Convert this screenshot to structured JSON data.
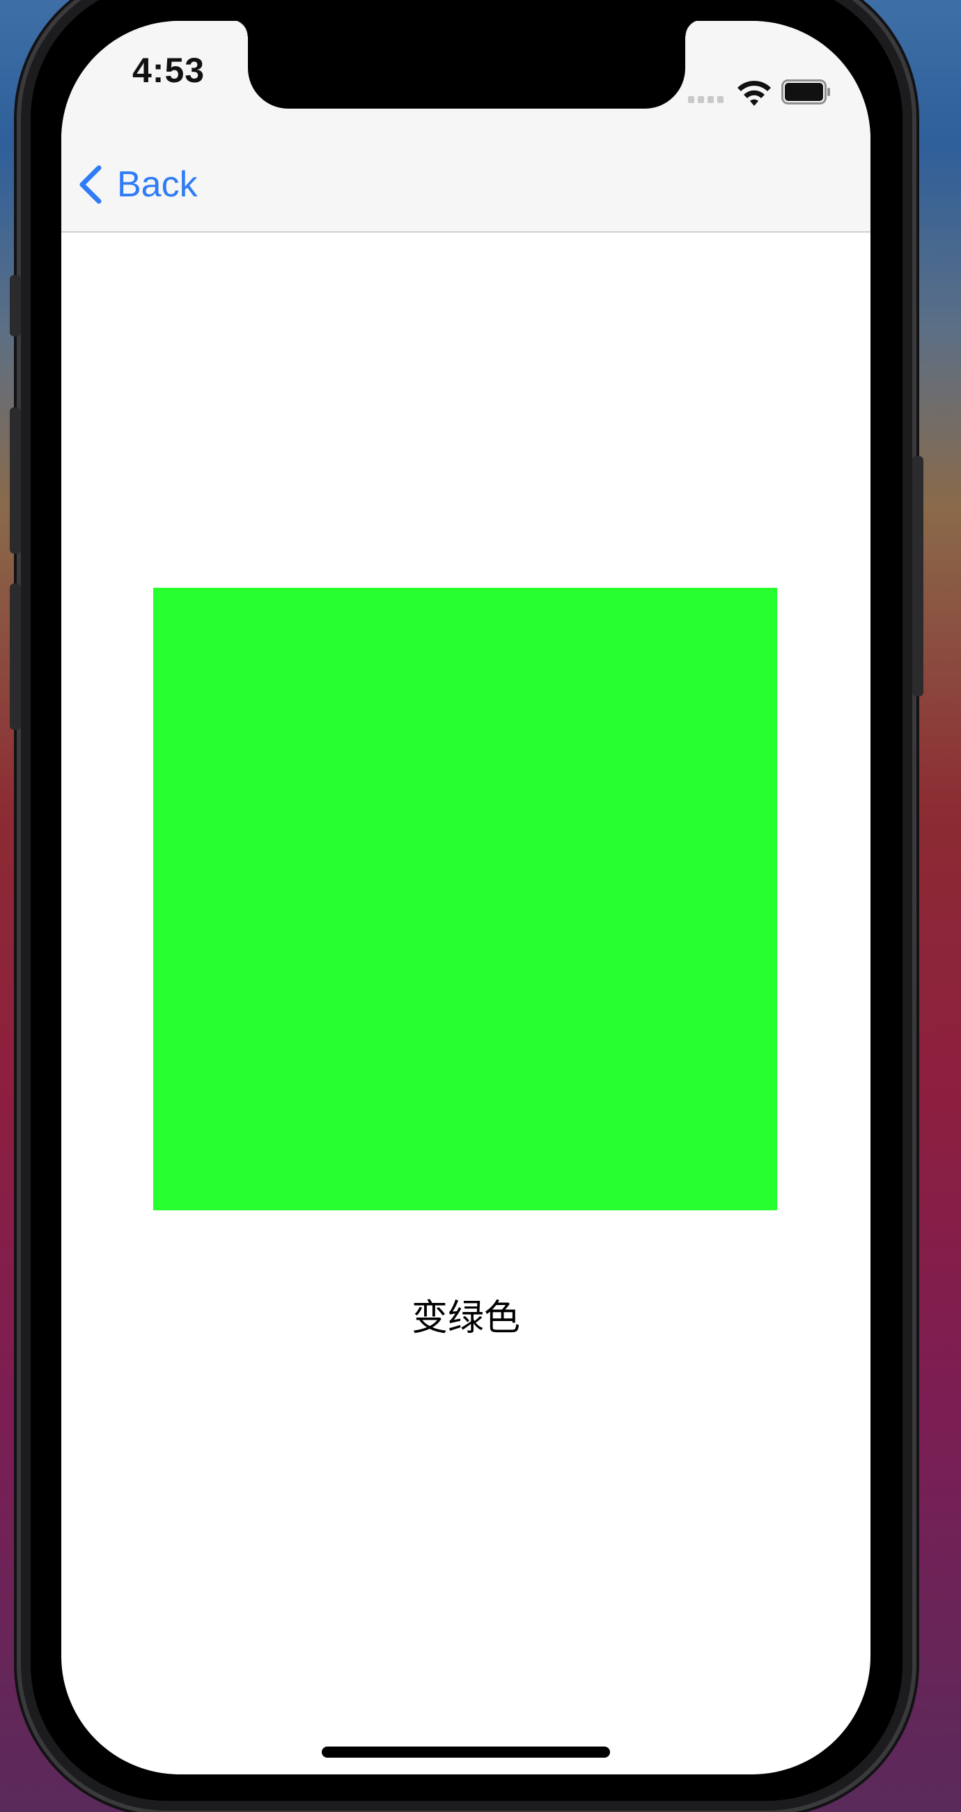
{
  "status_bar": {
    "time": "4:53",
    "icons": [
      "cellular-signal-icon",
      "wifi-icon",
      "battery-icon"
    ]
  },
  "nav_bar": {
    "back_label": "Back",
    "back_icon": "chevron-left-icon",
    "accent_color": "#2f7cf6"
  },
  "content": {
    "box_color": "#28ff2f",
    "caption": "变绿色"
  }
}
